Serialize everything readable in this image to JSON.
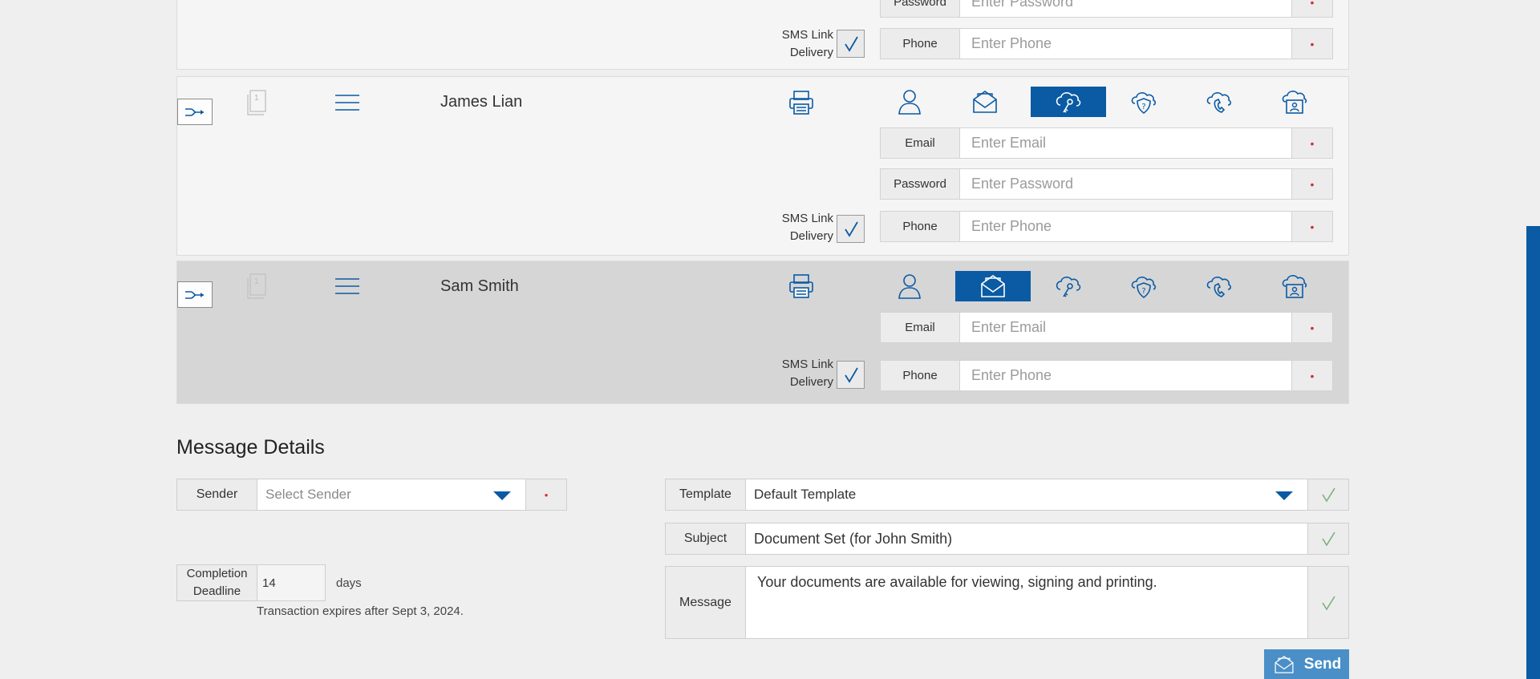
{
  "recipients": {
    "top": {
      "password_label": "Password",
      "password_placeholder": "Enter Password",
      "sms_label_line1": "SMS Link",
      "sms_label_line2": "Delivery",
      "phone_label": "Phone",
      "phone_placeholder": "Enter Phone",
      "required_mark": "•"
    },
    "james": {
      "name": "James Lian",
      "doc_count": "1",
      "active_auth": "key",
      "email_label": "Email",
      "email_placeholder": "Enter Email",
      "password_label": "Password",
      "password_placeholder": "Enter Password",
      "sms_label_line1": "SMS Link",
      "sms_label_line2": "Delivery",
      "phone_label": "Phone",
      "phone_placeholder": "Enter Phone",
      "required_mark": "•"
    },
    "sam": {
      "name": "Sam Smith",
      "doc_count": "1",
      "active_auth": "email",
      "email_label": "Email",
      "email_placeholder": "Enter Email",
      "sms_label_line1": "SMS Link",
      "sms_label_line2": "Delivery",
      "phone_label": "Phone",
      "phone_placeholder": "Enter Phone",
      "required_mark": "•"
    }
  },
  "message_details": {
    "title": "Message Details",
    "sender_label": "Sender",
    "sender_placeholder": "Select Sender",
    "required_mark": "•",
    "completion_label_line1": "Completion",
    "completion_label_line2": "Deadline",
    "completion_days": "14",
    "days_label": "days",
    "expiry_text": "Transaction expires after Sept 3, 2024.",
    "template_label": "Template",
    "template_value": "Default Template",
    "subject_label": "Subject",
    "subject_value": "Document Set (for John Smith)",
    "message_label": "Message",
    "message_value": "Your documents are available for viewing, signing and printing.",
    "send_label": "Send"
  },
  "colors": {
    "accent": "#0a5aa4",
    "send_button": "#4a8fc7",
    "required": "#d0303a",
    "check_green": "#7bb07b"
  }
}
